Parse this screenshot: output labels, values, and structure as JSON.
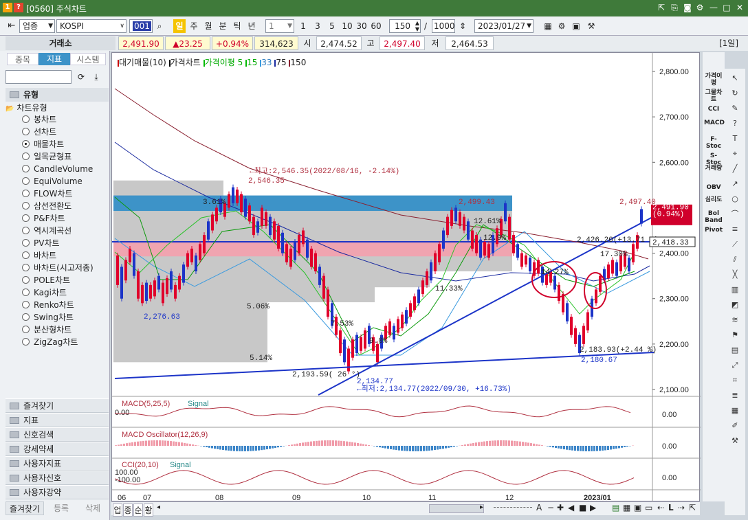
{
  "window": {
    "code": "[0560]",
    "title": "주식차트"
  },
  "toolbar": {
    "market": "업종",
    "index": "KOSPI",
    "period_buttons": [
      "일",
      "주",
      "월",
      "분",
      "틱",
      "년"
    ],
    "interval_value": "1",
    "quick_intervals": [
      "1",
      "3",
      "5",
      "10",
      "30",
      "60"
    ],
    "count": "150",
    "slash": "/",
    "total": "1000",
    "date": "2023/01/27"
  },
  "pricebar": {
    "exchange_label": "거래소",
    "last": "2,491.90",
    "change": "▲23.25",
    "pct": "+0.94%",
    "volume": "314,623",
    "open_label": "시",
    "open": "2,474.52",
    "high_label": "고",
    "high": "2,497.40",
    "low_label": "저",
    "low": "2,464.53",
    "period": "[1일]"
  },
  "left": {
    "tabs": [
      "종목",
      "지표",
      "시스템"
    ],
    "type_header": "유형",
    "group_label": "차트유형",
    "chart_types": [
      "봉차트",
      "선차트",
      "매물차트",
      "일목균형표",
      "CandleVolume",
      "EquiVolume",
      "FLOW차트",
      "삼선전환도",
      "P&F차트",
      "역시계곡선",
      "PV차트",
      "바차트",
      "바차트(시고저종)",
      "POLE차트",
      "Kagi차트",
      "Renko차트",
      "Swing차트",
      "분산형차트",
      "ZigZag차트"
    ],
    "selected": "매물차트",
    "sections": [
      "즐겨찾기",
      "지표",
      "신호검색",
      "강세약세",
      "사용자지표",
      "사용자신호",
      "사용자강약"
    ],
    "bottom_tabs": [
      "즐겨찾기",
      "등록",
      "삭제"
    ]
  },
  "chart": {
    "legend": {
      "vp": "대기매물(10)",
      "price": "가격차트",
      "ma": "가격이평",
      "ma5": "5",
      "ma15": "15",
      "ma33": "33",
      "ma75": "75",
      "ma150": "150"
    },
    "y_ticks": [
      "2,800.00",
      "2,700.00",
      "2,600.00",
      "2,500.00",
      "2,400.00",
      "2,300.00",
      "2,200.00",
      "2,100.00"
    ],
    "x_ticks": [
      "06",
      "07",
      "08",
      "09",
      "10",
      "11",
      "12",
      "2023/01"
    ],
    "annotations": {
      "high_note": "←최고:2,546.35(2022/08/16, -2.14%)",
      "high_val": "2,546.35",
      "low_note": "←최저:2,134.77(2022/09/30, +16.73%)",
      "low_val": "2,134.77",
      "a1": "2,276.63",
      "a2": "2,499.43",
      "a3": "2,497.40",
      "a4": "2,426.20(+13.71 %)",
      "a5": "2,183.93(+2.44 %)",
      "a6": "2,180.67",
      "a7": "2,193.59( 26 °)",
      "p1": "3.61%",
      "p2": "5.06%",
      "p3": "7.53%",
      "p4": "9.0%",
      "p5": "5.14%",
      "p6": "12.61%",
      "p7": "12.9%",
      "p8": "11.33%",
      "p9": "17.30%",
      "p10": "14.27%",
      "cur_price": "2,491.90",
      "cur_pct": "(0.94%)",
      "line_price": "2,418.33"
    },
    "macd": {
      "title": "MACD(5,25,5)",
      "signal": "Signal",
      "left_val": "0.00",
      "right_val": "0.00"
    },
    "osc": {
      "title": "MACD Oscillator(12,26,9)",
      "right_val": "0.00"
    },
    "cci": {
      "title": "CCI(20,10)",
      "signal": "Signal",
      "l1": "100.00",
      "l2": "-100.00",
      "right_val": "0.00"
    }
  },
  "rightbar": [
    "가격이평",
    "그물차트",
    "CCI",
    "MACD",
    "F-Stoc",
    "S-Stoc",
    "거래량",
    "OBV",
    "심리도",
    "Bol Band",
    "Pivot"
  ],
  "bottom": {
    "tabs": [
      "업",
      "종",
      "순",
      "황"
    ]
  },
  "colors": {
    "up": "#e0002b",
    "down": "#1c34c8",
    "title_green": "#3f7a3a",
    "vp_blue": "#3d93c8",
    "vp_red": "#f0a4b0",
    "vp_gray": "#c8c8c8"
  }
}
